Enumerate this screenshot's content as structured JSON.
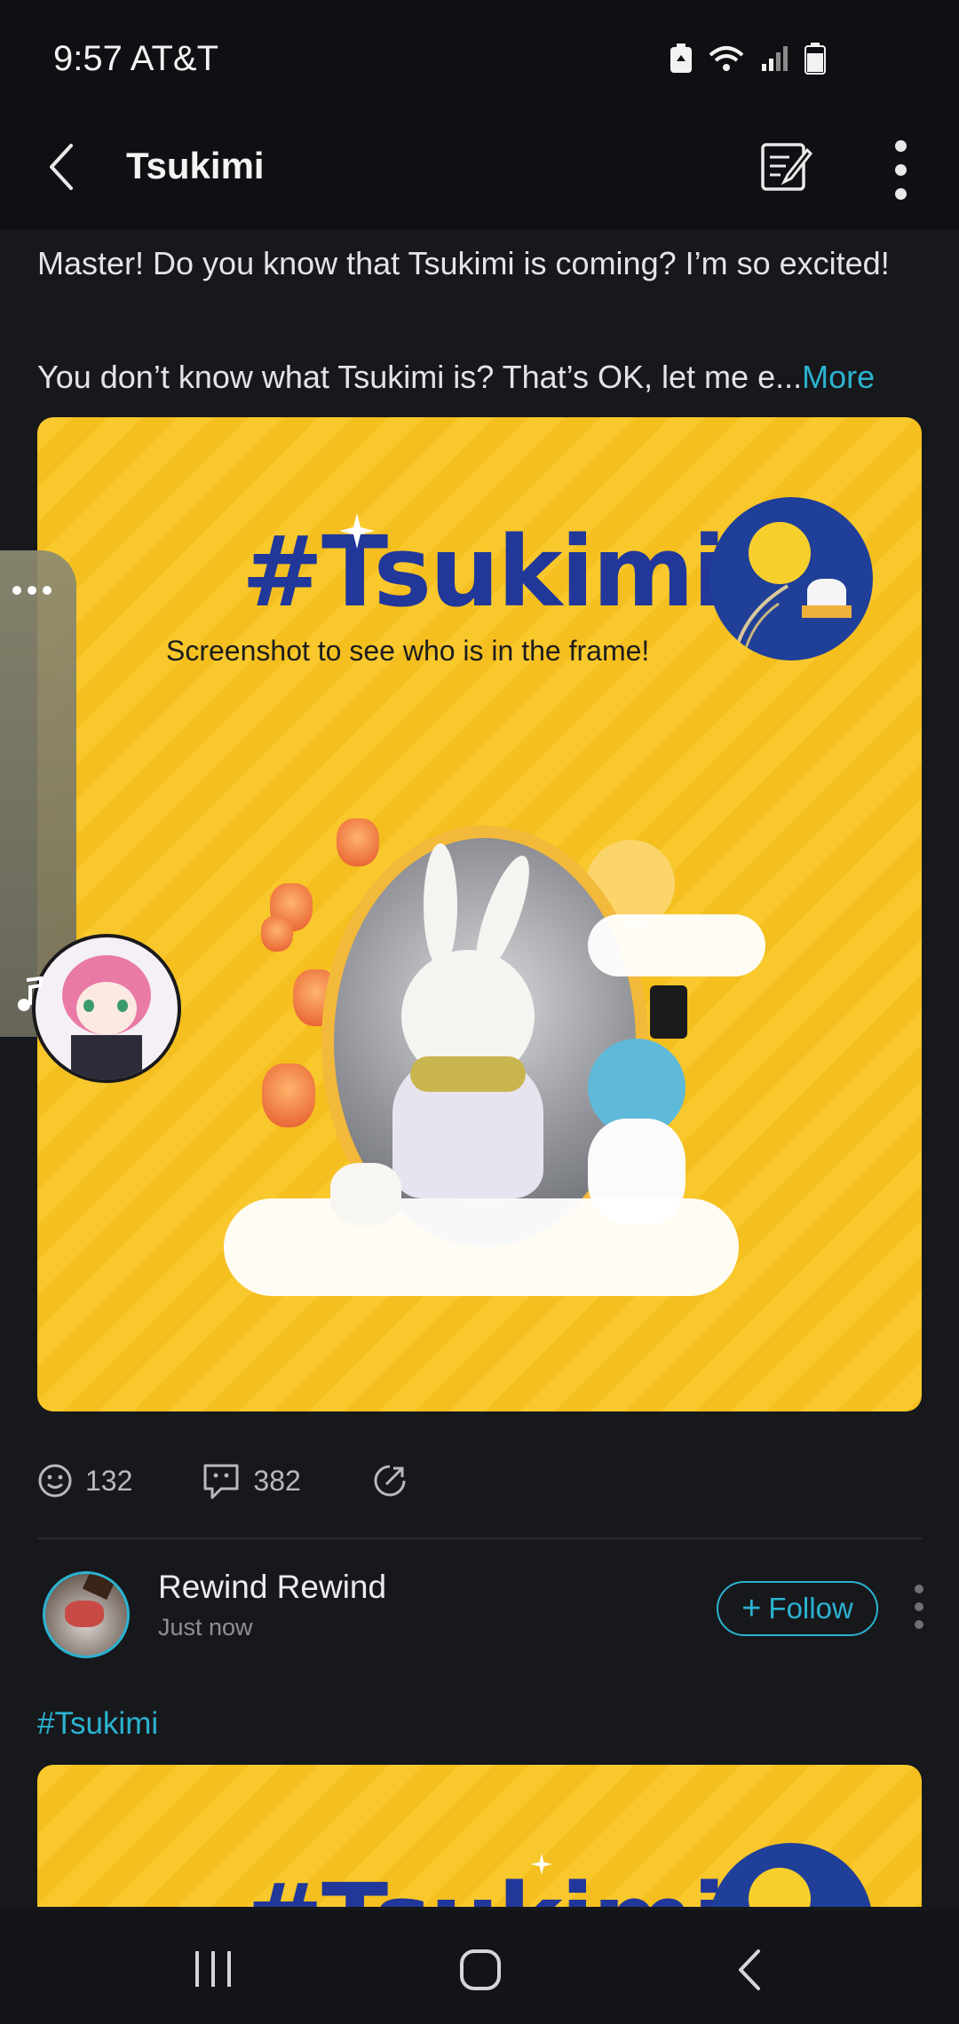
{
  "status_bar": {
    "time_carrier": "9:57 AT&T"
  },
  "app_bar": {
    "title": "Tsukimi",
    "back_icon": "chevron-left-icon",
    "compose_icon": "compose-icon",
    "menu_icon": "more-vertical-icon"
  },
  "post": {
    "line1": "Master! Do you know that Tsukimi is coming? I’m so excited!",
    "line2": "You don’t know what Tsukimi is? That’s OK, let me e...",
    "more_label": "More",
    "image": {
      "title": "#Tsukimi",
      "subtitle": "Screenshot to see who is in the frame!"
    },
    "stats": {
      "reactions": "132",
      "comments": "382"
    }
  },
  "second_post": {
    "author": "Rewind Rewind",
    "time": "Just now",
    "follow_label": "Follow",
    "hashtag": "#Tsukimi",
    "image_title": "#Tsukimi"
  },
  "colors": {
    "accent": "#2bb3d0",
    "background": "#17181c",
    "image_yellow": "#f9c82c",
    "title_blue": "#21379a"
  }
}
